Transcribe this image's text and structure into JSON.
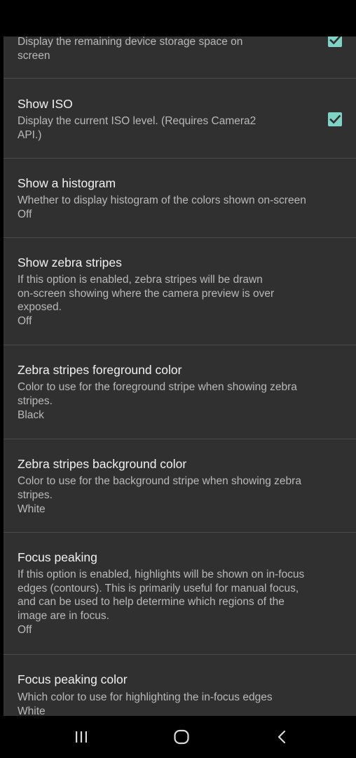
{
  "settings": {
    "items": [
      {
        "summary_lines": [
          "Display the remaining device storage space on",
          "screen"
        ],
        "checked": true
      },
      {
        "title": "Show ISO",
        "summary_lines": [
          "Display the current ISO level. (Requires Camera2",
          "API.)"
        ],
        "checked": true
      },
      {
        "title": "Show a histogram",
        "summary_lines": [
          "Whether to display histogram of the colors shown on-screen"
        ],
        "value": "Off"
      },
      {
        "title": "Show zebra stripes",
        "summary_lines": [
          "If this option is enabled, zebra stripes will be drawn",
          "on-screen showing where the camera preview is over",
          "exposed."
        ],
        "value": "Off"
      },
      {
        "title": "Zebra stripes foreground color",
        "summary_lines": [
          "Color to use for the foreground stripe when showing zebra",
          "stripes."
        ],
        "value": "Black"
      },
      {
        "title": "Zebra stripes background color",
        "summary_lines": [
          "Color to use for the background stripe when showing zebra",
          "stripes."
        ],
        "value": "White"
      },
      {
        "title": "Focus peaking",
        "summary_lines": [
          "If this option is enabled, highlights will be shown on in-focus",
          "edges (contours). This is primarily useful for manual focus,",
          "and can be used to help determine which regions of the",
          "image are in focus."
        ],
        "value": "Off"
      },
      {
        "title": "Focus peaking color",
        "summary_lines": [
          "Which color to use for highlighting the in-focus edges"
        ],
        "value": "White"
      }
    ]
  },
  "navigation": {
    "icons": [
      "recent-apps-icon",
      "home-icon",
      "back-icon"
    ]
  },
  "colors": {
    "background": "#303030",
    "divider": "#4a4a4a",
    "title_text": "#f1f1f1",
    "summary_text": "#b9b9b9",
    "checkbox_accent": "#7fd3c4",
    "system_bars": "#000000"
  }
}
